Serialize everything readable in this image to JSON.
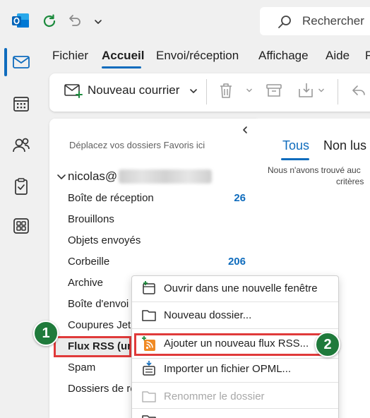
{
  "search": {
    "placeholder": "Rechercher"
  },
  "menu_tabs": [
    "Fichier",
    "Accueil",
    "Envoi/réception",
    "Affichage",
    "Aide",
    "R"
  ],
  "ribbon": {
    "new_mail_label": "Nouveau courrier"
  },
  "folder_pane": {
    "favorites_hint": "Déplacez vos dossiers Favoris ici",
    "account_name": "nicolas@",
    "folders": [
      {
        "label": "Boîte de réception",
        "count": "26"
      },
      {
        "label": "Brouillons",
        "count": ""
      },
      {
        "label": "Objets envoyés",
        "count": ""
      },
      {
        "label": "Corbeille",
        "count": "206"
      },
      {
        "label": "Archive",
        "count": ""
      },
      {
        "label": "Boîte d'envoi",
        "count": ""
      },
      {
        "label": "Coupures Jetp",
        "count": ""
      },
      {
        "label": "Flux RSS (un",
        "count": ""
      },
      {
        "label": "Spam",
        "count": ""
      },
      {
        "label": "Dossiers de re",
        "count": ""
      }
    ]
  },
  "message_list": {
    "tabs": [
      "Tous",
      "Non lus"
    ],
    "empty_line1": "Nous n'avons trouvé auc",
    "empty_line2": "critères"
  },
  "context_menu": {
    "items": [
      {
        "label": "Ouvrir dans une nouvelle fenêtre",
        "icon": "new-window-icon",
        "disabled": false
      },
      {
        "label": "Nouveau dossier...",
        "icon": "folder-icon",
        "disabled": false
      },
      {
        "label": "Ajouter un nouveau flux RSS...",
        "icon": "rss-add-icon",
        "disabled": false
      },
      {
        "label": "Importer un fichier OPML...",
        "icon": "import-opml-icon",
        "disabled": false
      },
      {
        "label": "Renommer le dossier",
        "icon": "rename-folder-icon",
        "disabled": true
      }
    ]
  },
  "badges": {
    "step1": "1",
    "step2": "2"
  },
  "colors": {
    "accent": "#0f6cbd",
    "highlight": "#e03a3a",
    "badge": "#1f7a3b"
  }
}
